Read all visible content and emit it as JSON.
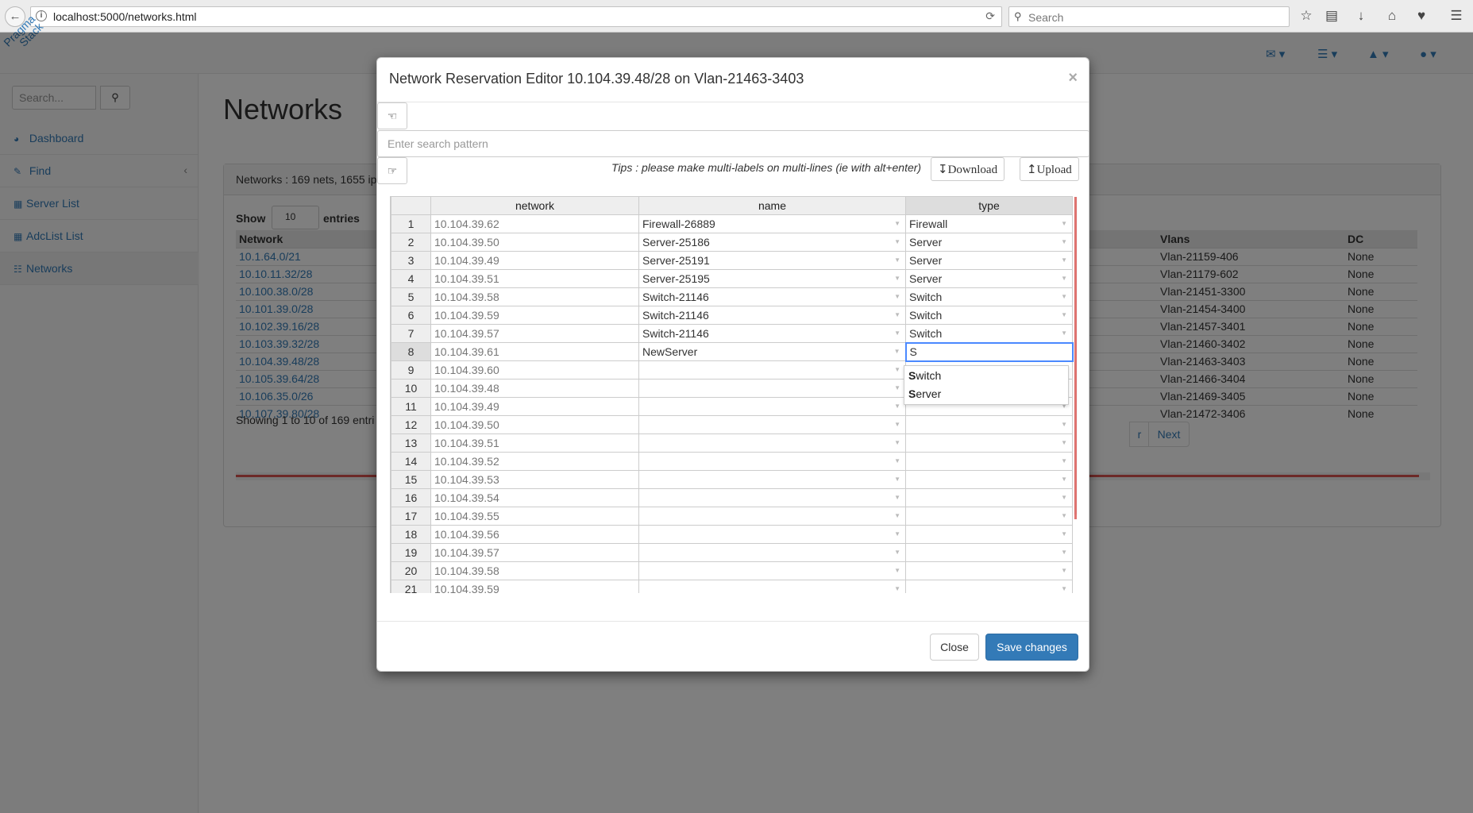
{
  "browser": {
    "url": "localhost:5000/networks.html",
    "search_placeholder": "Search"
  },
  "app": {
    "brand_line1": "Pragma",
    "brand_line2": "Stack",
    "sidebar_search_placeholder": "Search...",
    "sidebar": [
      {
        "label": "Dashboard",
        "icon": "dashboard-icon"
      },
      {
        "label": "Find",
        "icon": "edit-icon"
      },
      {
        "label": "Server List",
        "icon": "table-icon"
      },
      {
        "label": "AdcList List",
        "icon": "table-icon"
      },
      {
        "label": "Networks",
        "icon": "sitemap-icon"
      }
    ]
  },
  "page": {
    "title": "Networks",
    "summary": "Networks : 169 nets, 1655 ip",
    "show_label": "Show",
    "entries_value": "10",
    "entries_label": "entries",
    "columns": {
      "network": "Network",
      "vlans": "Vlans",
      "dc": "DC"
    },
    "rows": [
      {
        "network": "10.1.64.0/21",
        "vlan": "Vlan-21159-406",
        "dc": "None"
      },
      {
        "network": "10.10.11.32/28",
        "vlan": "Vlan-21179-602",
        "dc": "None"
      },
      {
        "network": "10.100.38.0/28",
        "vlan": "Vlan-21451-3300",
        "dc": "None"
      },
      {
        "network": "10.101.39.0/28",
        "vlan": "Vlan-21454-3400",
        "dc": "None"
      },
      {
        "network": "10.102.39.16/28",
        "vlan": "Vlan-21457-3401",
        "dc": "None"
      },
      {
        "network": "10.103.39.32/28",
        "vlan": "Vlan-21460-3402",
        "dc": "None"
      },
      {
        "network": "10.104.39.48/28",
        "vlan": "Vlan-21463-3403",
        "dc": "None"
      },
      {
        "network": "10.105.39.64/28",
        "vlan": "Vlan-21466-3404",
        "dc": "None"
      },
      {
        "network": "10.106.35.0/26",
        "vlan": "Vlan-21469-3405",
        "dc": "None"
      },
      {
        "network": "10.107.39.80/28",
        "vlan": "Vlan-21472-3406",
        "dc": "None"
      }
    ],
    "showing": "Showing 1 to 10 of 169 entri",
    "next_label": "Next",
    "prev_fragment": "r"
  },
  "modal": {
    "title": "Network Reservation Editor 10.104.39.48/28 on Vlan-21463-3403",
    "close_x": "×",
    "search_placeholder": "Enter search pattern",
    "tips": "Tips : please make multi-labels on multi-lines (ie with alt+enter)",
    "download_label": "Download",
    "upload_label": "Upload",
    "grid_headers": {
      "network": "network",
      "name": "name",
      "type": "type"
    },
    "grid_rows": [
      {
        "n": "1",
        "network": "10.104.39.62",
        "name": "Firewall-26889",
        "type": "Firewall"
      },
      {
        "n": "2",
        "network": "10.104.39.50",
        "name": "Server-25186",
        "type": "Server"
      },
      {
        "n": "3",
        "network": "10.104.39.49",
        "name": "Server-25191",
        "type": "Server"
      },
      {
        "n": "4",
        "network": "10.104.39.51",
        "name": "Server-25195",
        "type": "Server"
      },
      {
        "n": "5",
        "network": "10.104.39.58",
        "name": "Switch-21146",
        "type": "Switch"
      },
      {
        "n": "6",
        "network": "10.104.39.59",
        "name": "Switch-21146",
        "type": "Switch"
      },
      {
        "n": "7",
        "network": "10.104.39.57",
        "name": "Switch-21146",
        "type": "Switch"
      },
      {
        "n": "8",
        "network": "10.104.39.61",
        "name": "NewServer",
        "type": "S"
      },
      {
        "n": "9",
        "network": "10.104.39.60",
        "name": "",
        "type": ""
      },
      {
        "n": "10",
        "network": "10.104.39.48",
        "name": "",
        "type": ""
      },
      {
        "n": "11",
        "network": "10.104.39.49",
        "name": "",
        "type": ""
      },
      {
        "n": "12",
        "network": "10.104.39.50",
        "name": "",
        "type": ""
      },
      {
        "n": "13",
        "network": "10.104.39.51",
        "name": "",
        "type": ""
      },
      {
        "n": "14",
        "network": "10.104.39.52",
        "name": "",
        "type": ""
      },
      {
        "n": "15",
        "network": "10.104.39.53",
        "name": "",
        "type": ""
      },
      {
        "n": "16",
        "network": "10.104.39.54",
        "name": "",
        "type": ""
      },
      {
        "n": "17",
        "network": "10.104.39.55",
        "name": "",
        "type": ""
      },
      {
        "n": "18",
        "network": "10.104.39.56",
        "name": "",
        "type": ""
      },
      {
        "n": "19",
        "network": "10.104.39.57",
        "name": "",
        "type": ""
      },
      {
        "n": "20",
        "network": "10.104.39.58",
        "name": "",
        "type": ""
      },
      {
        "n": "21",
        "network": "10.104.39.59",
        "name": "",
        "type": ""
      }
    ],
    "autocomplete": [
      {
        "bold": "S",
        "rest": "witch"
      },
      {
        "bold": "S",
        "rest": "erver"
      }
    ],
    "close_label": "Close",
    "save_label": "Save changes"
  }
}
